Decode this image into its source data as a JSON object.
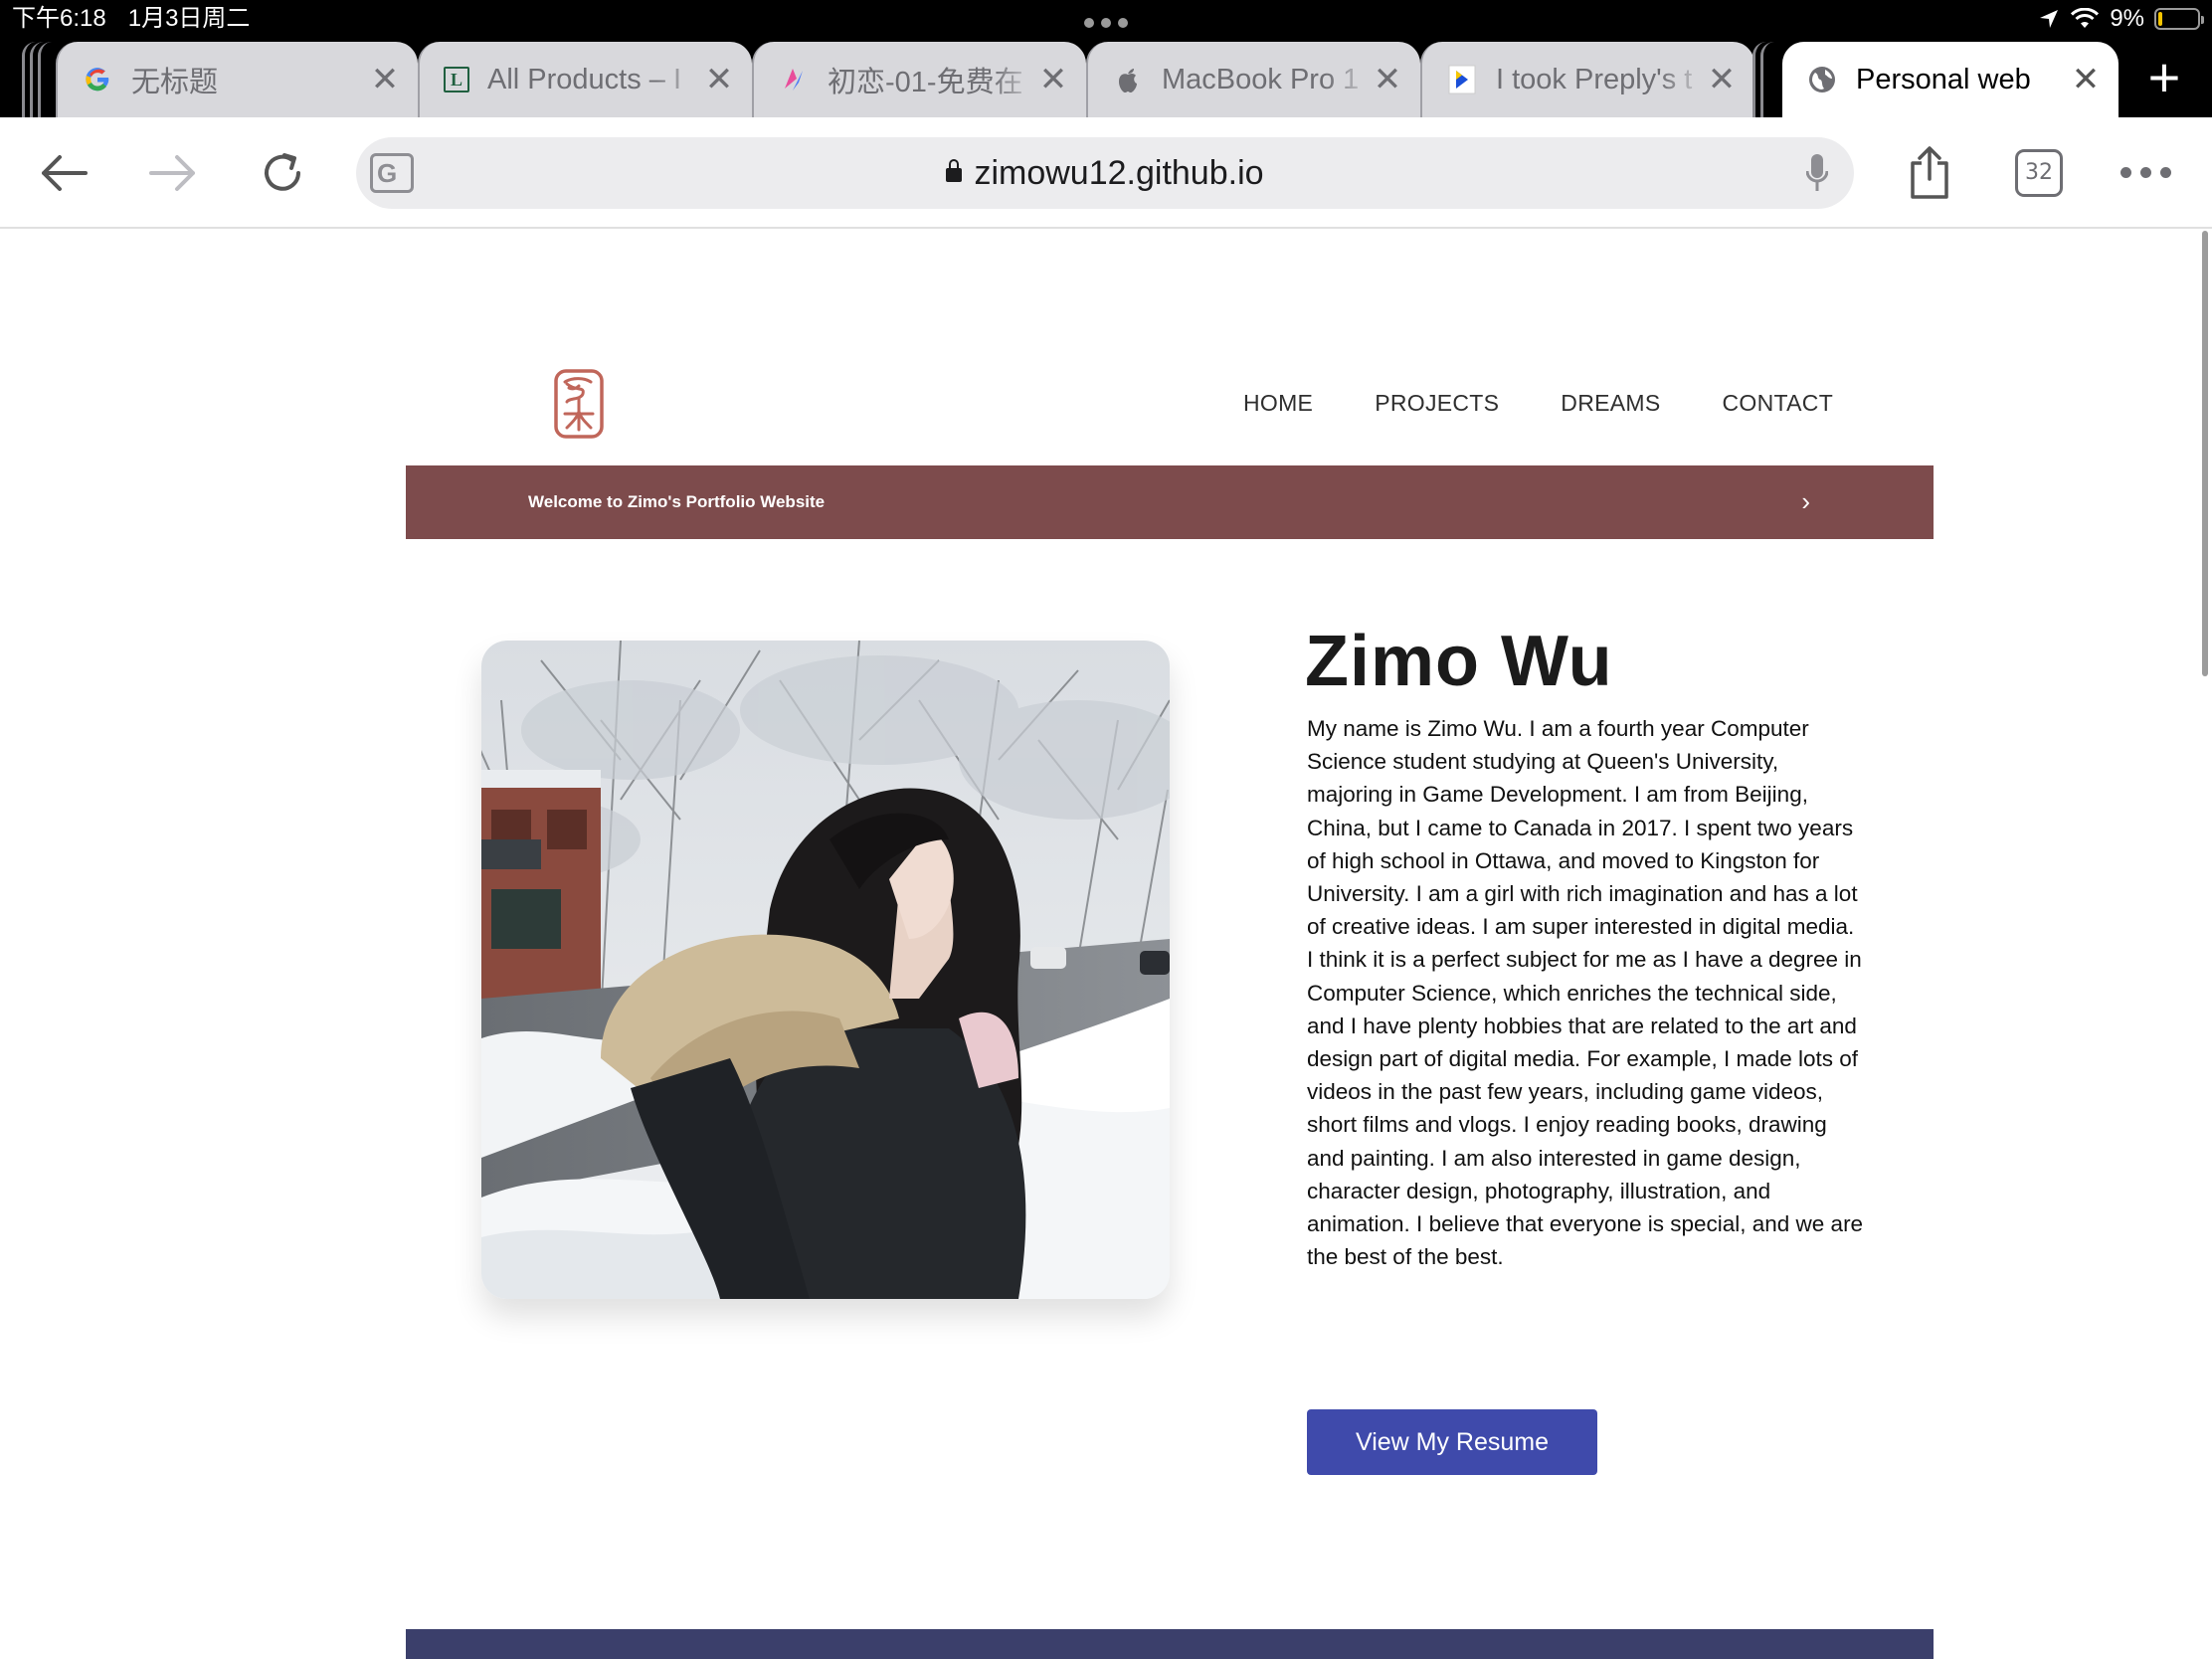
{
  "status_bar": {
    "time": "下午6:18",
    "date": "1月3日周二",
    "battery": "9%",
    "battery_level": 0.09
  },
  "tabs": [
    {
      "title": "无标题",
      "icon": "google-icon",
      "active": false
    },
    {
      "title": "All Products – I",
      "icon": "lp-logo-icon",
      "active": false
    },
    {
      "title": "初恋-01-免费在",
      "icon": "swirl-logo-icon",
      "active": false
    },
    {
      "title": "MacBook Pro 1",
      "icon": "apple-icon",
      "active": false
    },
    {
      "title": "I took Preply's t",
      "icon": "preply-icon",
      "active": false
    },
    {
      "title": "Personal web",
      "icon": "globe-icon",
      "active": true
    }
  ],
  "toolbar": {
    "url": "zimowu12.github.io",
    "tab_count": "32",
    "icons": [
      "back-arrow-icon",
      "forward-arrow-icon",
      "reload-icon",
      "translate-icon",
      "microphone-icon",
      "share-icon",
      "more-icon"
    ]
  },
  "site": {
    "nav": [
      "HOME",
      "PROJECTS",
      "DREAMS",
      "CONTACT"
    ],
    "banner": "Welcome to Zimo's Portfolio Website",
    "banner_arrow": "›",
    "name": "Zimo Wu",
    "bio": "My name is Zimo Wu. I am a fourth year Computer Science student studying at Queen's University, majoring in Game Development. I am from Beijing, China, but I came to Canada in 2017. I spent two years of high school in Ottawa, and moved to Kingston for University. I am a girl with rich imagination and has a lot of creative ideas. I am super interested in digital media. I think it is a perfect subject for me as I have a degree in Computer Science, which enriches the technical side, and I have plenty hobbies that are related to the art and design part of digital media. For example, I made lots of videos in the past few years, including game videos, short films and vlogs. I enjoy reading books, drawing and painting. I am also interested in game design, character design, photography, illustration, and animation. I believe that everyone is special, and we are the best of the best.",
    "resume_button": "View My Resume"
  },
  "colors": {
    "banner": "#7d4b4c",
    "button": "#3f4aab",
    "footer": "#3b3f6b",
    "logo": "#c0665a"
  }
}
